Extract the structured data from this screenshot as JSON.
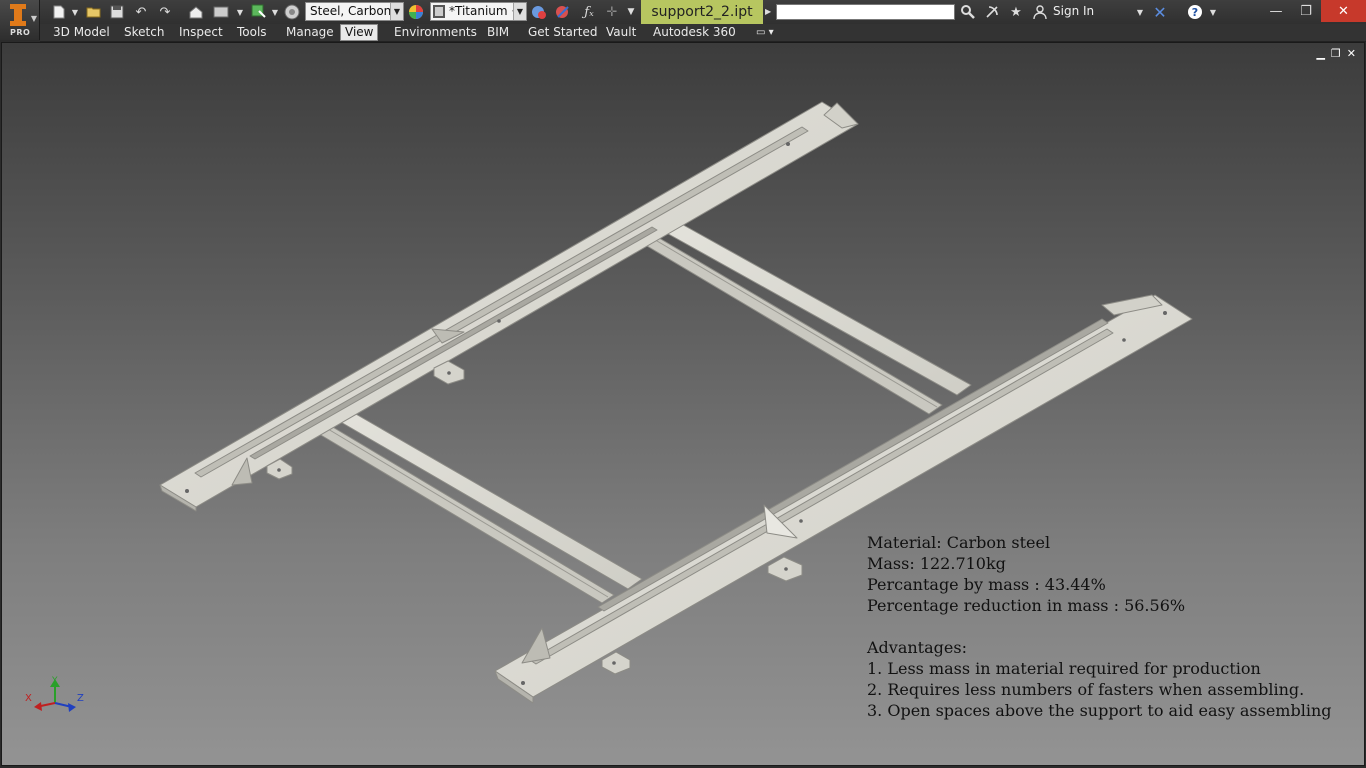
{
  "app": {
    "badge": "PRO"
  },
  "quick_access": {
    "material_value": "Steel, Carbon",
    "appearance_value": "*Titanium ·"
  },
  "document": {
    "tab_label": "support2_2.ipt"
  },
  "search": {
    "placeholder": ""
  },
  "account": {
    "sign_in_label": "Sign In"
  },
  "ribbon": {
    "tabs": [
      {
        "label": "3D Model"
      },
      {
        "label": "Sketch"
      },
      {
        "label": "Inspect"
      },
      {
        "label": "Tools"
      },
      {
        "label": "Manage"
      },
      {
        "label": "View"
      },
      {
        "label": "Environments"
      },
      {
        "label": "BIM"
      },
      {
        "label": "Get Started"
      },
      {
        "label": "Vault"
      },
      {
        "label": "Autodesk 360"
      }
    ],
    "active_tab": "View"
  },
  "notes": {
    "material": "Material: Carbon steel",
    "mass": "Mass: 122.710kg",
    "percent_by_mass": "Percantage by mass : 43.44%",
    "percent_reduction": "Percentage reduction in mass : 56.56%",
    "advantages_heading": "Advantages:",
    "advantages": [
      "1. Less mass in material required for production",
      "2. Requires less numbers of fasters when assembling.",
      "3. Open spaces above the support to aid easy assembling"
    ]
  },
  "triad": {
    "x": "X",
    "y": "Y",
    "z": "Z"
  },
  "colors": {
    "title_bar": "#333333",
    "document_tab": "#b7c660",
    "close_button": "#c7392b",
    "part_face": "#d9d8d0",
    "part_edge": "#8d8c86"
  },
  "icons": [
    "inventor-logo-icon",
    "new-file-icon",
    "open-icon",
    "save-icon",
    "undo-icon",
    "redo-icon",
    "home-icon",
    "update-icon",
    "select-icon",
    "material-icon",
    "appearance-icon",
    "clear-appearance-icon",
    "adjust-appearance-icon",
    "parameters-icon",
    "search-icon",
    "comm-center-icon",
    "favorites-icon",
    "user-icon",
    "x-exchange-icon",
    "help-icon"
  ]
}
